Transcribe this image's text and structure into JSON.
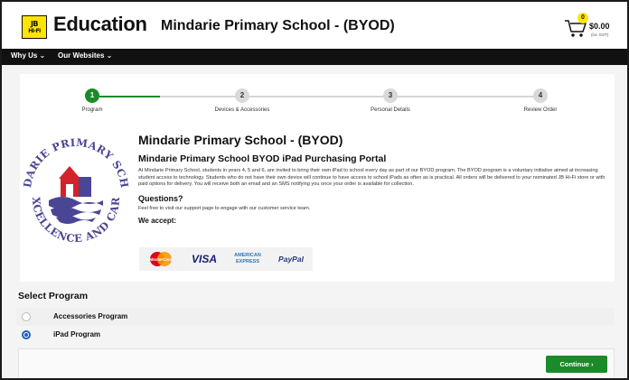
{
  "header": {
    "logo_line1": "JB",
    "logo_line2": "HI-FI",
    "logo_text": "Education",
    "school_title": "Mindarie Primary School - (BYOD)",
    "cart_count": "0",
    "cart_amount": "$0.00",
    "cart_tax_note": "(inc GST)"
  },
  "nav": {
    "items": [
      {
        "label": "Why Us ⌄"
      },
      {
        "label": "Our Websites ⌄"
      }
    ]
  },
  "stepper": {
    "steps": [
      {
        "number": "1",
        "label": "Program",
        "active": true
      },
      {
        "number": "2",
        "label": "Devices & Accessories",
        "active": false
      },
      {
        "number": "3",
        "label": "Personal Details",
        "active": false
      },
      {
        "number": "4",
        "label": "Review Order",
        "active": false
      }
    ]
  },
  "school_logo": {
    "top_text": "MINDARIE PRIMARY SCHOOL",
    "bottom_text": "EXCELLENCE AND CARE"
  },
  "main": {
    "heading": "Mindarie Primary School - (BYOD)",
    "subheading": "Mindarie Primary School BYOD iPad Purchasing Portal",
    "description": "At Mindarie Primary School, students in years 4, 5 and 6, are invited to bring their own iPad to school every day as part of our BYOD program. The BYOD program is a voluntary initiative aimed at increasing student access to technology. Students who do not have their own device will continue to have access to school iPads as often as is practical. All orders will be delivered to your nominated JB Hi-Fi store or with paid options for delivery. You will receive both an email and an SMS notifying you once your order is available for collection.",
    "questions_heading": "Questions?",
    "questions_text": "Feel free to visit our support page to engage with our customer service team.",
    "accept_heading": "We accept:",
    "payment_methods": [
      {
        "name": "MasterCard"
      },
      {
        "name": "VISA"
      },
      {
        "name": "AMERICAN EXPRESS"
      },
      {
        "name": "PayPal"
      }
    ]
  },
  "select_program": {
    "title": "Select Program",
    "options": [
      {
        "label": "Accessories Program",
        "selected": false
      },
      {
        "label": "iPad Program",
        "selected": true
      }
    ]
  },
  "footer": {
    "continue_label": "Continue  ›"
  },
  "colors": {
    "brand_yellow": "#ffe600",
    "step_green": "#1a8a2a",
    "radio_blue": "#1f5fbf",
    "nav_black": "#111111"
  }
}
